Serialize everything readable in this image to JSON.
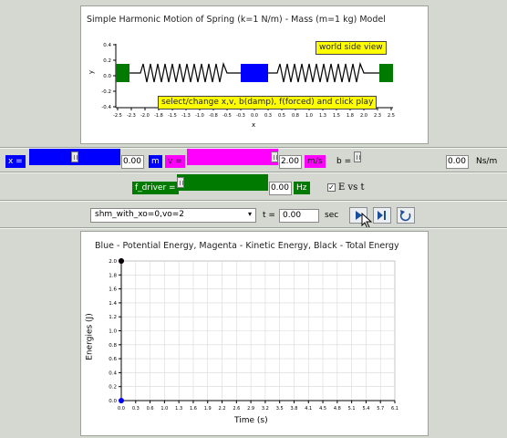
{
  "spring_panel": {
    "title": "Simple Harmonic Motion of Spring (k=1 N/m) - Mass (m=1 kg) Model",
    "ylabel": "y",
    "xlabel": "x",
    "view_label": "world side view",
    "hint_label": "select/change x,v, b(damp), f(forced) and click play",
    "yticks": [
      "0.4",
      "0.2",
      "0.0",
      "-0.2",
      "-0.4"
    ],
    "xticks": [
      "-2.5",
      "-2.3",
      "-2.0",
      "-1.8",
      "-1.5",
      "-1.3",
      "-1.0",
      "-0.8",
      "-0.5",
      "-0.3",
      "0.0",
      "0.3",
      "0.5",
      "0.8",
      "1.0",
      "1.3",
      "1.5",
      "1.8",
      "2.0",
      "2.3",
      "2.5"
    ],
    "colors": {
      "wall": "#007a00",
      "mass": "#0000ff",
      "spring": "#000000"
    }
  },
  "controls_row1": {
    "x_label": "x =",
    "x_value": "0.00",
    "x_unit": "m",
    "v_label": "v =",
    "v_value": "2.00",
    "v_unit": "m/s",
    "b_label": "b =",
    "b_value": "0.00",
    "b_unit": "Ns/m",
    "x_slider_fraction": 0.5,
    "v_slider_fraction": 1.0,
    "b_slider_fraction": 0.0
  },
  "controls_row2": {
    "f_label": "f_driver =",
    "f_value": "0.00",
    "f_unit": "Hz",
    "f_slider_fraction": 0.0,
    "evst_label": "E vs t",
    "evst_checked": true
  },
  "controls_row3": {
    "preset_selected": "shm_with_xo=0,vo=2",
    "t_label": "t =",
    "t_value": "0.00",
    "t_unit": "sec",
    "play_icon": "play-icon",
    "step_icon": "step-forward-icon",
    "reset_icon": "reset-icon"
  },
  "chart_data": {
    "type": "scatter",
    "title": "Blue - Potential Energy, Magenta - Kinetic Energy, Black - Total Energy",
    "xlabel": "Time (s)",
    "ylabel": "Energies (J)",
    "xticks": [
      "0.0",
      "0.3",
      "0.6",
      "1.0",
      "1.3",
      "1.6",
      "1.9",
      "2.2",
      "2.6",
      "2.9",
      "3.2",
      "3.5",
      "3.8",
      "4.1",
      "4.5",
      "4.8",
      "5.1",
      "5.4",
      "5.7",
      "6.1"
    ],
    "yticks": [
      "2.0",
      "1.8",
      "1.6",
      "1.4",
      "1.2",
      "1.0",
      "0.8",
      "0.6",
      "0.4",
      "0.2",
      "0.0"
    ],
    "xlim": [
      0,
      6.1
    ],
    "ylim": [
      0,
      2.0
    ],
    "grid": true,
    "series": [
      {
        "name": "Potential Energy",
        "color": "#0000ff",
        "x": [
          0.0
        ],
        "y": [
          0.0
        ]
      },
      {
        "name": "Kinetic Energy",
        "color": "#ff00ff",
        "x": [
          0.0
        ],
        "y": [
          2.0
        ]
      },
      {
        "name": "Total Energy",
        "color": "#000000",
        "x": [
          0.0
        ],
        "y": [
          2.0
        ]
      }
    ]
  }
}
